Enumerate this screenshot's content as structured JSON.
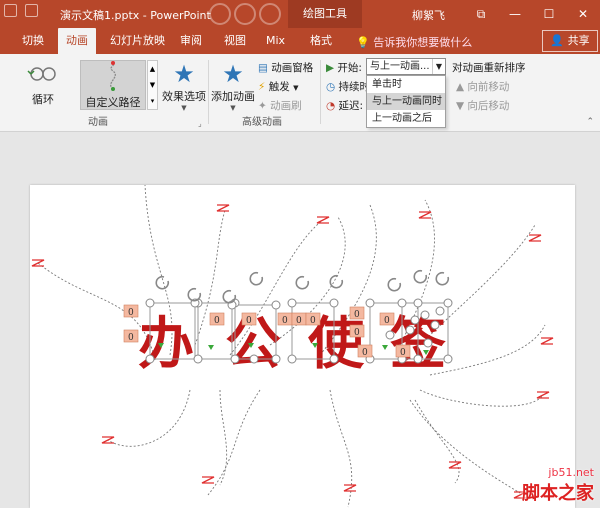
{
  "window": {
    "title": "演示文稿1.pptx - PowerPoint",
    "context_tab_group": "绘图工具",
    "user": "柳絮飞",
    "minimize": "—",
    "restore": "☐",
    "close": "✕"
  },
  "tabs": [
    {
      "label": "切换"
    },
    {
      "label": "动画"
    },
    {
      "label": "幻灯片放映"
    },
    {
      "label": "审阅"
    },
    {
      "label": "视图"
    },
    {
      "label": "Mix"
    },
    {
      "label": "格式"
    }
  ],
  "tell_me": "告诉我你想要做什么",
  "share": "共享",
  "ribbon": {
    "animation_gallery": {
      "items": [
        {
          "label": "循环"
        },
        {
          "label": "自定义路径"
        }
      ],
      "effect_options": "效果选项",
      "group_label": "动画"
    },
    "advanced": {
      "add_animation": "添加动画",
      "animation_pane": "动画窗格",
      "trigger": "触发",
      "painter": "动画刷",
      "group_label": "高级动画"
    },
    "timing": {
      "start_label": "开始:",
      "start_value": "与上一动画...",
      "duration_label": "持续时",
      "delay_label": "延迟:",
      "reorder_title": "对动画重新排序",
      "move_earlier": "向前移动",
      "move_later": "向后移动",
      "menu": [
        {
          "label": "单击时"
        },
        {
          "label": "与上一动画同时"
        },
        {
          "label": "上一动画之后"
        }
      ]
    }
  },
  "slide": {
    "text": [
      "办",
      "公",
      "使",
      "签"
    ],
    "tag_labels": [
      "0",
      "0",
      "0",
      "0",
      "0",
      "0",
      "0",
      "0",
      "0",
      "0",
      "0",
      "0"
    ]
  },
  "watermark": {
    "line1": "jb51.net",
    "line2": "脚本之家"
  },
  "colors": {
    "accent": "#b7472a",
    "text_red": "#c01818",
    "path_end": "#e03030"
  }
}
